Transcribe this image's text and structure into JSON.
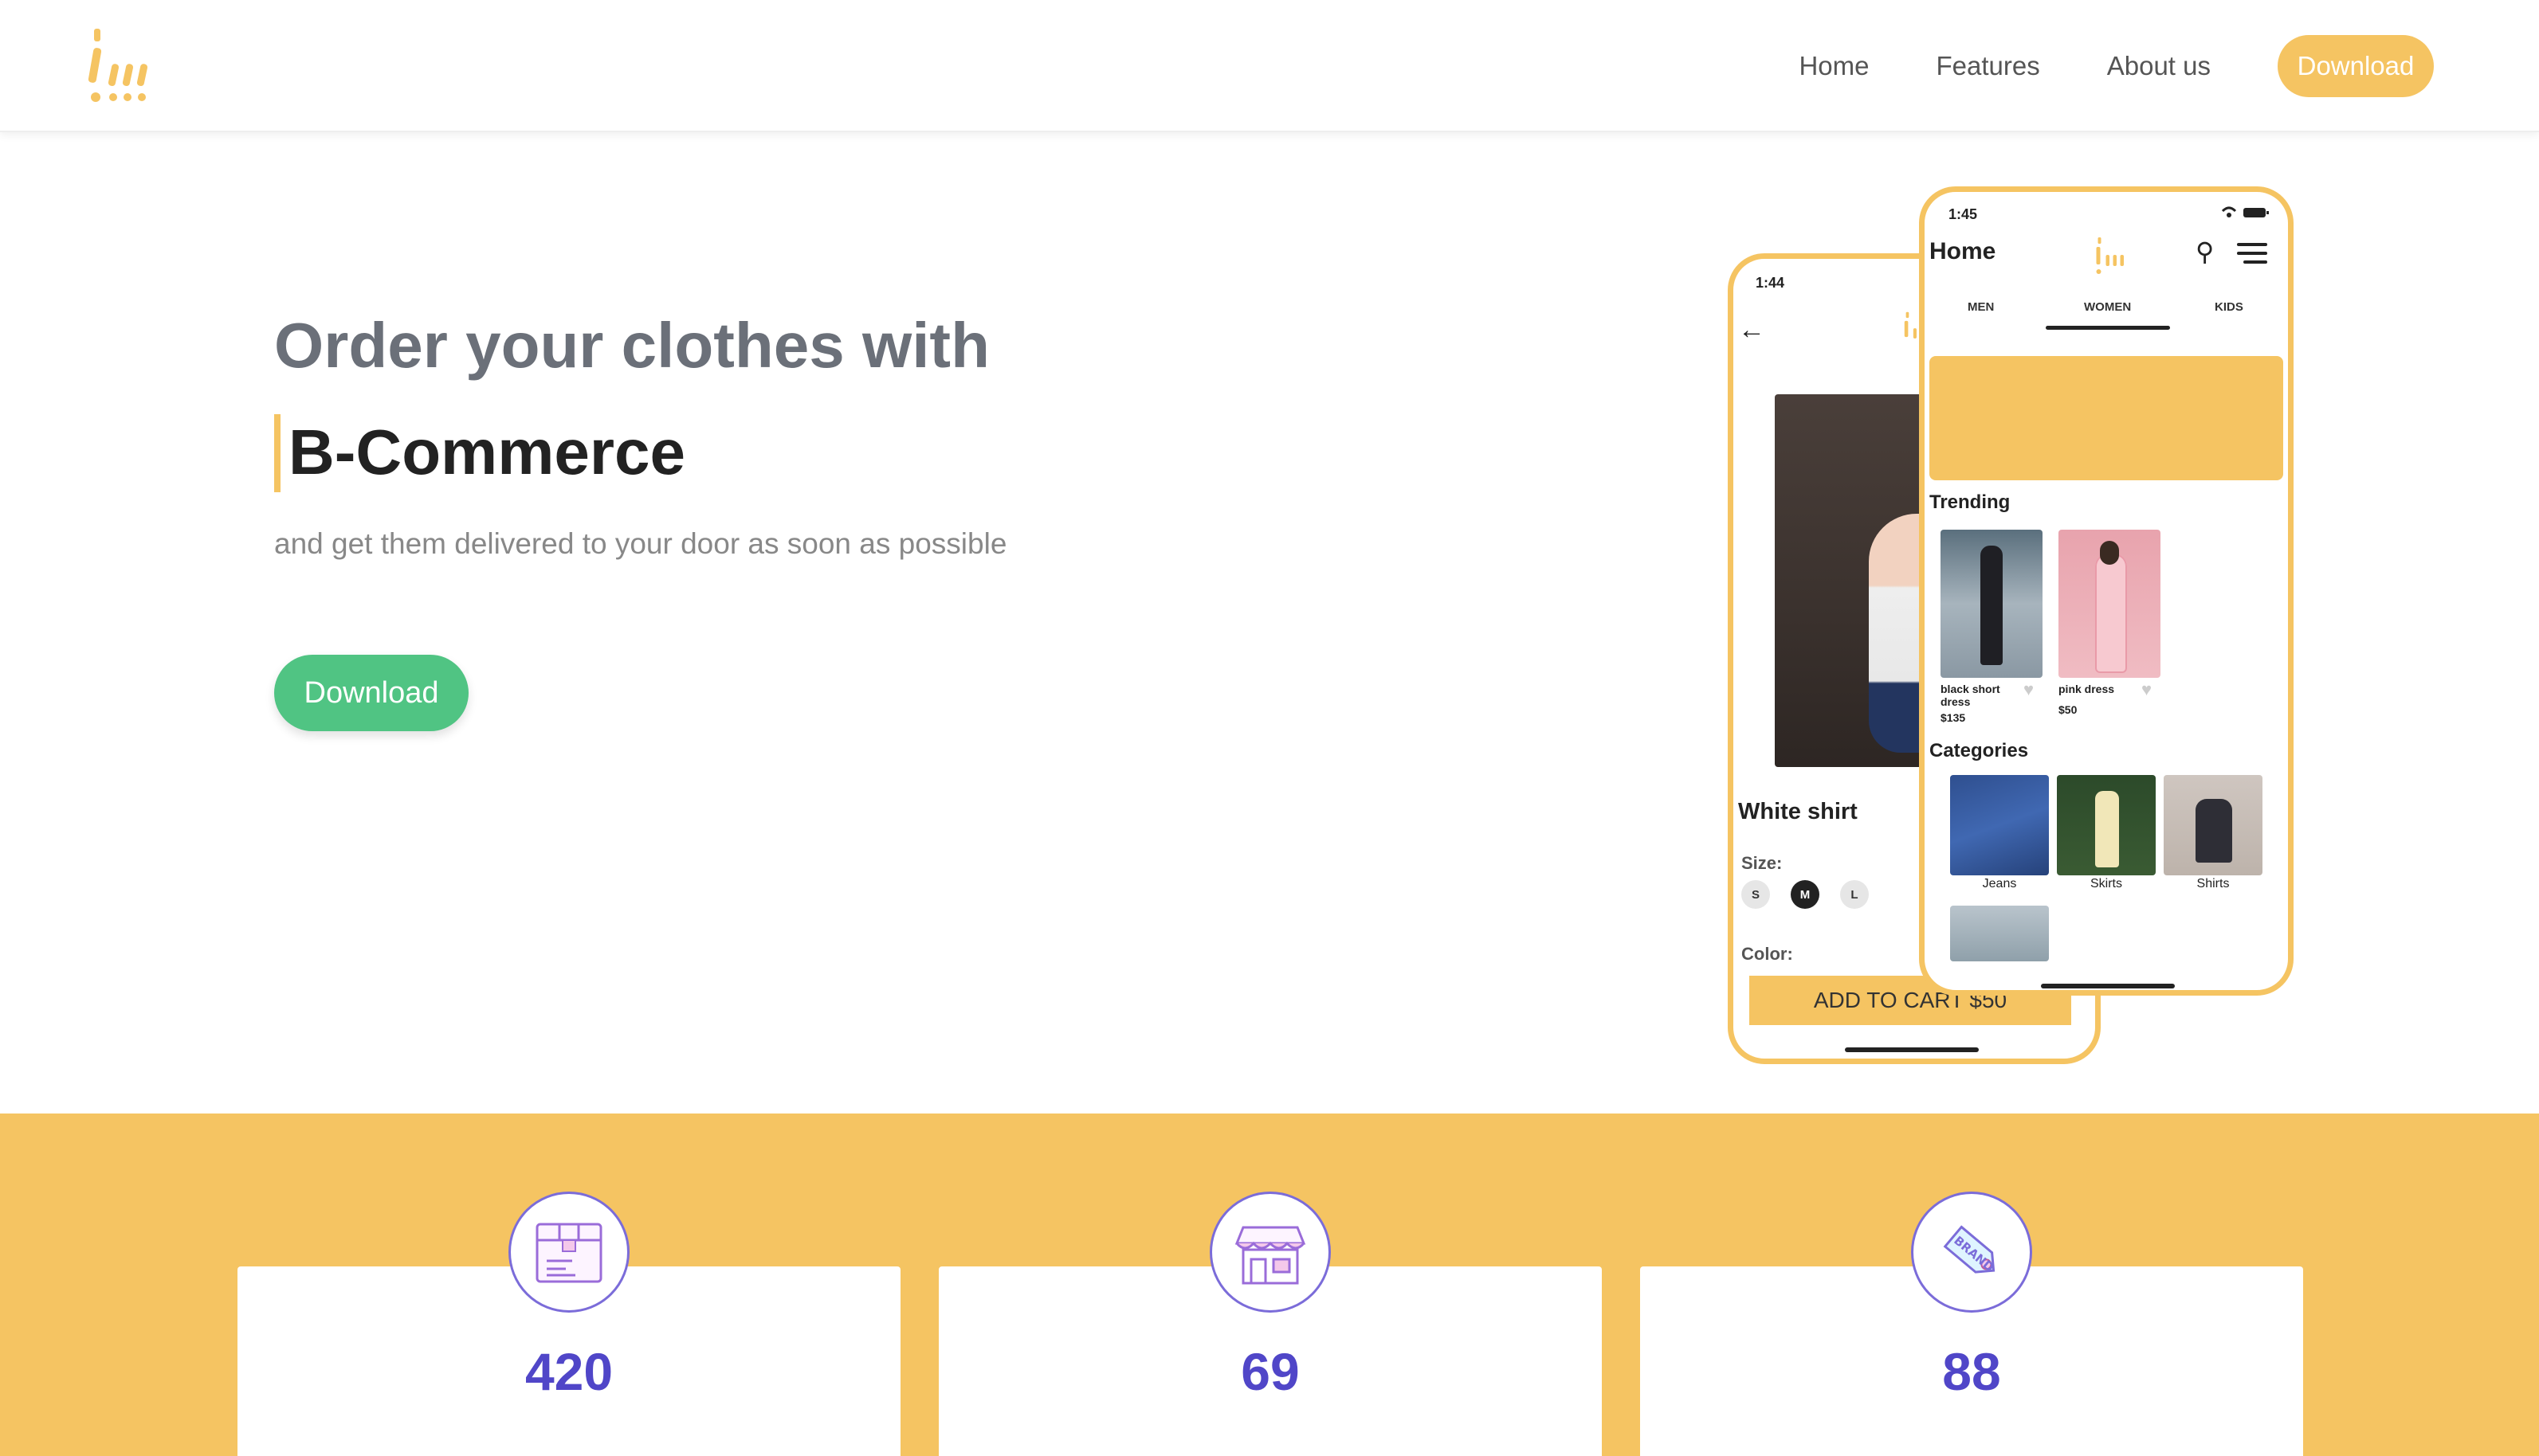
{
  "nav": {
    "logo_icon": "brand-logo-icon",
    "links": [
      "Home",
      "Features",
      "About us"
    ],
    "download_label": "Download"
  },
  "hero": {
    "line1": "Order your clothes with",
    "brand": "B-Commerce",
    "subtitle": "and get them delivered to your door as soon as possible",
    "download_label": "Download"
  },
  "phone_product": {
    "time": "1:44",
    "title": "White shirt",
    "size_label": "Size:",
    "sizes": [
      "S",
      "M",
      "L"
    ],
    "selected_size": "M",
    "color_label": "Color:",
    "cart_label": "ADD TO CART $50"
  },
  "phone_home": {
    "time": "1:45",
    "title": "Home",
    "tabs": [
      "MEN",
      "WOMEN",
      "KIDS"
    ],
    "active_tab": "WOMEN",
    "trending_label": "Trending",
    "trending": [
      {
        "name": "black short dress",
        "price": "$135"
      },
      {
        "name": "pink dress",
        "price": "$50"
      }
    ],
    "categories_label": "Categories",
    "categories": [
      "Jeans",
      "Skirts",
      "Shirts"
    ]
  },
  "stats": [
    {
      "value": "420",
      "icon": "package-box-icon"
    },
    {
      "value": "69",
      "icon": "storefront-icon"
    },
    {
      "value": "88",
      "icon": "brand-tag-icon"
    }
  ],
  "colors": {
    "accent": "#F5C462",
    "green": "#50C483",
    "stat_number": "#5046c8"
  }
}
